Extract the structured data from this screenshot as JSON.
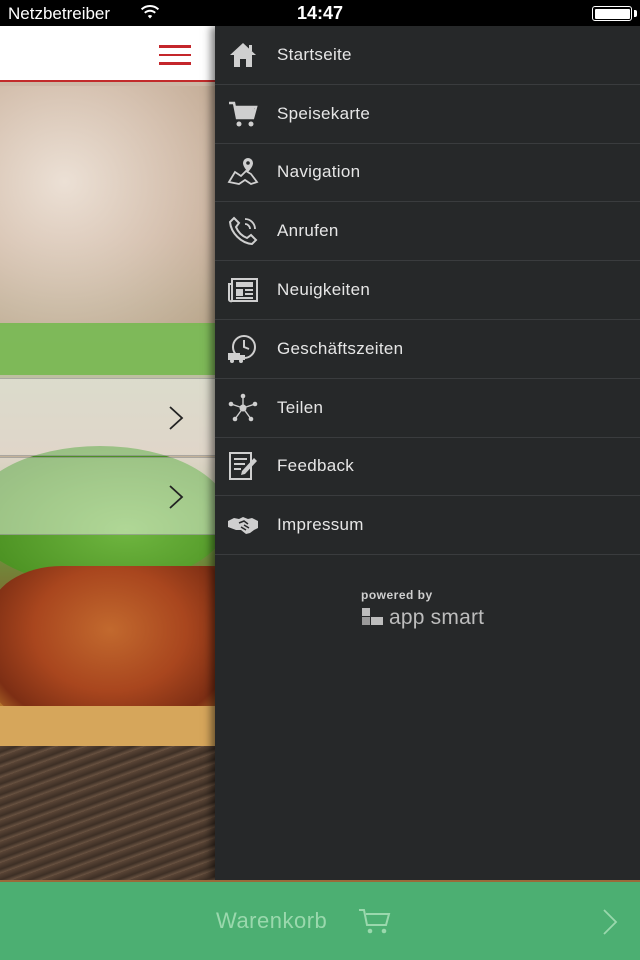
{
  "status_bar": {
    "carrier": "Netzbetreiber",
    "time": "14:47"
  },
  "menu": {
    "items": [
      {
        "label": "Startseite",
        "icon": "home-icon"
      },
      {
        "label": "Speisekarte",
        "icon": "cart-icon"
      },
      {
        "label": "Navigation",
        "icon": "map-pin-icon"
      },
      {
        "label": "Anrufen",
        "icon": "phone-icon"
      },
      {
        "label": "Neuigkeiten",
        "icon": "newspaper-icon"
      },
      {
        "label": "Geschäftszeiten",
        "icon": "clock-truck-icon"
      },
      {
        "label": "Teilen",
        "icon": "share-network-icon"
      },
      {
        "label": "Feedback",
        "icon": "feedback-form-icon"
      },
      {
        "label": "Impressum",
        "icon": "handshake-icon"
      }
    ],
    "powered_by": "powered by",
    "brand": "app smart"
  },
  "cart": {
    "label": "Warenkorb"
  },
  "colors": {
    "menu_bg": "#262829",
    "accent_red": "#c4262b",
    "cart_green": "#4caf72",
    "list_green": "#7ab854"
  }
}
